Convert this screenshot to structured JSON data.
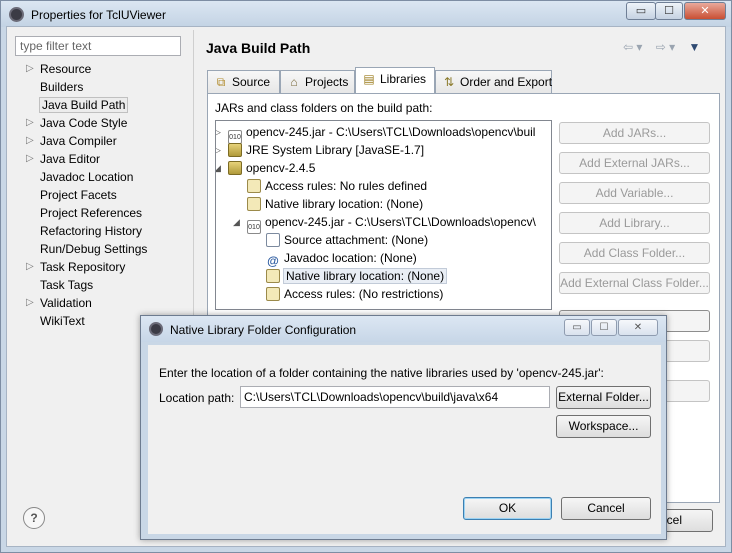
{
  "main_window": {
    "title": "Properties for TclUViewer",
    "caption_buttons": [
      "▭",
      "☐",
      "✕"
    ]
  },
  "nav": {
    "filter_placeholder": "type filter text",
    "items": [
      {
        "label": "Resource",
        "expandable": true
      },
      {
        "label": "Builders",
        "expandable": false
      },
      {
        "label": "Java Build Path",
        "expandable": false,
        "selected": true
      },
      {
        "label": "Java Code Style",
        "expandable": true
      },
      {
        "label": "Java Compiler",
        "expandable": true
      },
      {
        "label": "Java Editor",
        "expandable": true
      },
      {
        "label": "Javadoc Location",
        "expandable": false
      },
      {
        "label": "Project Facets",
        "expandable": false
      },
      {
        "label": "Project References",
        "expandable": false
      },
      {
        "label": "Refactoring History",
        "expandable": false
      },
      {
        "label": "Run/Debug Settings",
        "expandable": false
      },
      {
        "label": "Task Repository",
        "expandable": true
      },
      {
        "label": "Task Tags",
        "expandable": false
      },
      {
        "label": "Validation",
        "expandable": true
      },
      {
        "label": "WikiText",
        "expandable": false
      }
    ]
  },
  "page": {
    "title": "Java Build Path",
    "tabs": [
      "Source",
      "Projects",
      "Libraries",
      "Order and Export"
    ],
    "active_tab": "Libraries",
    "panel_heading": "JARs and class folders on the build path:",
    "tree": [
      {
        "text": "opencv-245.jar - C:\\Users\\TCL\\Downloads\\opencv\\buil",
        "icon": "jar",
        "twisty": "▷"
      },
      {
        "text": "JRE System Library [JavaSE-1.7]",
        "icon": "lib",
        "twisty": "▷"
      },
      {
        "text": "opencv-2.4.5",
        "icon": "lib",
        "twisty": "◢"
      },
      {
        "text": "Access rules: No rules defined",
        "icon": "rule",
        "twisty": ""
      },
      {
        "text": "Native library location: (None)",
        "icon": "rule",
        "twisty": ""
      },
      {
        "text": "opencv-245.jar - C:\\Users\\TCL\\Downloads\\opencv\\",
        "icon": "jar",
        "twisty": "◢"
      },
      {
        "text": "Source attachment: (None)",
        "icon": "src",
        "twisty": ""
      },
      {
        "text": "Javadoc location: (None)",
        "icon": "at",
        "twisty": ""
      },
      {
        "text": "Native library location: (None)",
        "icon": "rule",
        "twisty": "",
        "highlight": true
      },
      {
        "text": "Access rules: (No restrictions)",
        "icon": "rule",
        "twisty": ""
      }
    ],
    "side_buttons": [
      "Add JARs...",
      "Add External JARs...",
      "Add Variable...",
      "Add Library...",
      "Add Class Folder...",
      "Add External Class Folder..."
    ],
    "partial_cancel": "ncel",
    "help_glyph": "?"
  },
  "dialog": {
    "title": "Native Library Folder Configuration",
    "message": "Enter the location of a folder containing the native libraries used by 'opencv-245.jar':",
    "location_label": "Location path:",
    "location_value": "C:\\Users\\TCL\\Downloads\\opencv\\build\\java\\x64",
    "external_folder_button": "External Folder...",
    "workspace_button": "Workspace...",
    "ok_button": "OK",
    "cancel_button": "Cancel",
    "caption_buttons": [
      "▭",
      "☐",
      "✕"
    ]
  },
  "icons": {
    "tab_source": "source-folder-icon",
    "tab_projects": "projects-icon",
    "tab_libraries": "libraries-icon",
    "tab_order": "order-export-icon"
  }
}
